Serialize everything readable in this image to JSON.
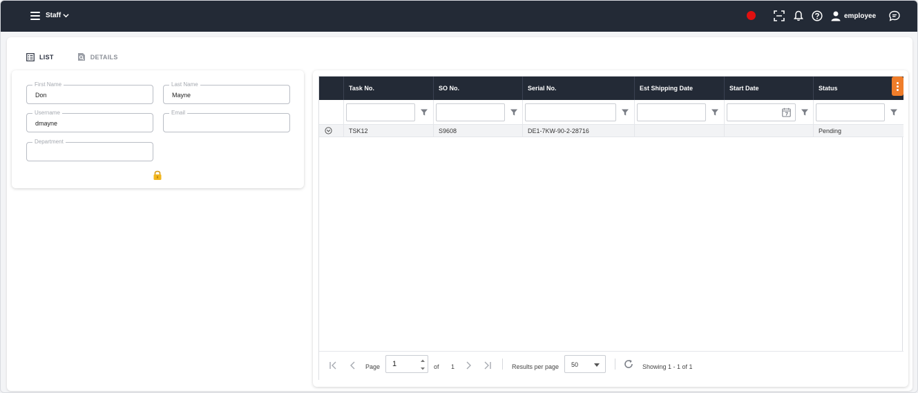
{
  "topbar": {
    "app_name": "Staff",
    "user_name": "employee",
    "record_color": "#e01010"
  },
  "tabs": [
    {
      "label": "LIST",
      "icon": "list-icon",
      "active": true
    },
    {
      "label": "DETAILS",
      "icon": "details-search-icon",
      "active": false
    }
  ],
  "form": {
    "first_name": {
      "label": "First Name",
      "value": "Don"
    },
    "last_name": {
      "label": "Last Name",
      "value": "Mayne"
    },
    "username": {
      "label": "Username",
      "value": "dmayne"
    },
    "email": {
      "label": "Email",
      "value": ""
    },
    "department": {
      "label": "Department",
      "value": ""
    },
    "lock_icon": "lock-icon"
  },
  "grid": {
    "columns": [
      "",
      "Task No.",
      "SO No.",
      "Serial No.",
      "Est Shipping Date",
      "Start Date",
      "Status"
    ],
    "rows": [
      {
        "task_no": "TSK12",
        "so_no": "S9608",
        "serial_no": "DE1-7KW-90-2-28716",
        "est_shipping_date": "",
        "start_date": "",
        "status": "Pending"
      }
    ],
    "accent_color": "#ef7d2a"
  },
  "pager": {
    "page_label": "Page",
    "page_value": "1",
    "of_label": "of",
    "total_pages": "1",
    "results_label": "Results per page",
    "per_page": "50",
    "showing": "Showing 1 - 1 of 1"
  }
}
